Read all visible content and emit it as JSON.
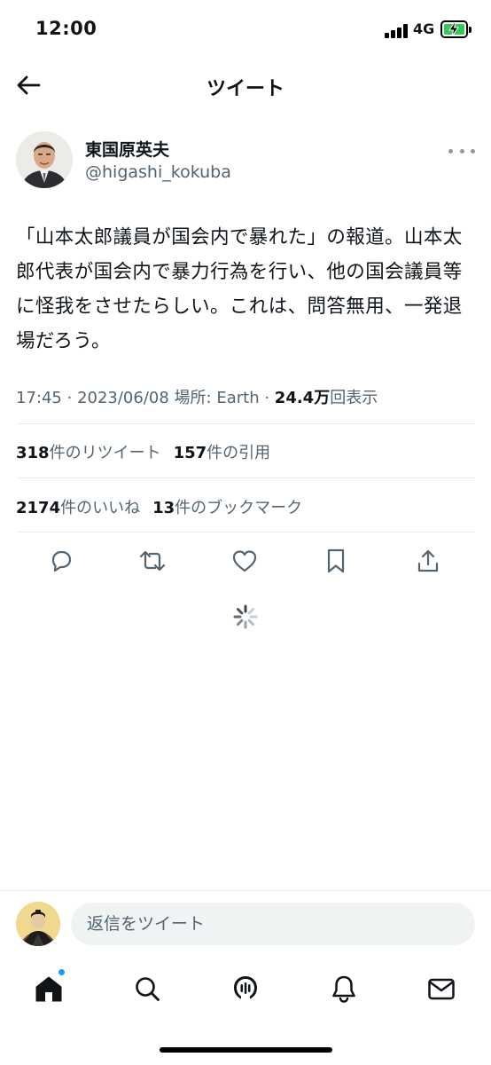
{
  "status_bar": {
    "time": "12:00",
    "network": "4G",
    "battery": "charging"
  },
  "header": {
    "title": "ツイート",
    "back_icon": "back-arrow-icon"
  },
  "author": {
    "name": "東国原英夫",
    "handle": "@higashi_kokuba"
  },
  "tweet": {
    "text": "「山本太郎議員が国会内で暴れた」の報道。山本太郎代表が国会内で暴力行為を行い、他の国会議員等に怪我をさせたらしい。これは、問答無用、一発退場だろう。",
    "time": "17:45",
    "date": "2023/06/08",
    "location": "場所: Earth",
    "views_value": "24.4万",
    "views_label": "回表示"
  },
  "stats": {
    "retweets_count": "318",
    "retweets_label": "件のリツイート",
    "quotes_count": "157",
    "quotes_label": "件の引用",
    "likes_count": "2174",
    "likes_label": "件のいいね",
    "bookmarks_count": "13",
    "bookmarks_label": "件のブックマーク"
  },
  "actions": [
    "reply-icon",
    "retweet-icon",
    "like-icon",
    "bookmark-icon",
    "share-icon"
  ],
  "reply": {
    "placeholder": "返信をツイート"
  },
  "tabbar": {
    "items": [
      "home-icon",
      "search-icon",
      "spaces-icon",
      "notifications-icon",
      "messages-icon"
    ],
    "home_has_notification": true
  },
  "colors": {
    "text_primary": "#0f1419",
    "text_secondary": "#536471",
    "accent": "#1d9bf0",
    "divider": "#e6ecf0",
    "battery": "#34c759"
  }
}
